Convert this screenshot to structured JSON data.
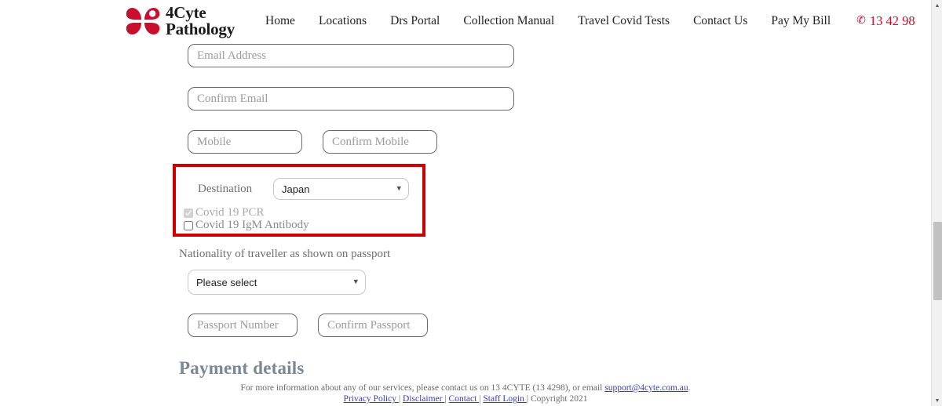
{
  "header": {
    "brand": {
      "line1": "4Cyte",
      "line2": "Pathology",
      "logo_icon": "clover-logo-icon",
      "brand_color": "#c8102e"
    },
    "nav_items": [
      {
        "label": "Home"
      },
      {
        "label": "Locations"
      },
      {
        "label": "Drs Portal"
      },
      {
        "label": "Collection Manual"
      },
      {
        "label": "Travel Covid Tests"
      },
      {
        "label": "Contact Us"
      },
      {
        "label": "Pay My Bill"
      }
    ],
    "phone": {
      "icon": "phone-icon",
      "number": "13 42 98",
      "color": "#c8102e"
    }
  },
  "form": {
    "email": {
      "placeholder": "Email Address",
      "value": ""
    },
    "confirm_email": {
      "placeholder": "Confirm Email",
      "value": ""
    },
    "mobile": {
      "placeholder": "Mobile",
      "value": ""
    },
    "confirm_mobile": {
      "placeholder": "Confirm Mobile",
      "value": ""
    },
    "destination": {
      "label": "Destination",
      "selected": "Japan",
      "options": [
        "Japan"
      ],
      "chevron": "⌄"
    },
    "tests": [
      {
        "label": "Covid 19 PCR",
        "checked": true,
        "disabled": true
      },
      {
        "label": "Covid 19 IgM Antibody",
        "checked": false,
        "disabled": false
      }
    ],
    "nationality": {
      "label": "Nationality of traveller as shown on passport",
      "selected": "Please select",
      "options": [
        "Please select"
      ],
      "chevron": "⌄"
    },
    "passport_number": {
      "placeholder": "Passport Number",
      "value": ""
    },
    "confirm_passport": {
      "placeholder": "Confirm Passport",
      "value": ""
    },
    "payment_heading": "Payment details",
    "highlight_color": "#cc0000"
  },
  "footer": {
    "line1_pre": "For more information about any of our services, please contact us on 13 4CYTE (13 4298), or email ",
    "email_link": "support@4cyte.com.au",
    "line1_post": ".",
    "links": [
      {
        "label": "Privacy Policy "
      },
      {
        "label": "Disclaimer "
      },
      {
        "label": "Contact "
      },
      {
        "label": "Staff Login "
      }
    ],
    "separator": "|",
    "copyright": "Copyright 2021",
    "link_color": "#3b3bb0"
  },
  "scrollbar": {
    "up_arrow": "▲",
    "down_arrow": "▼"
  }
}
